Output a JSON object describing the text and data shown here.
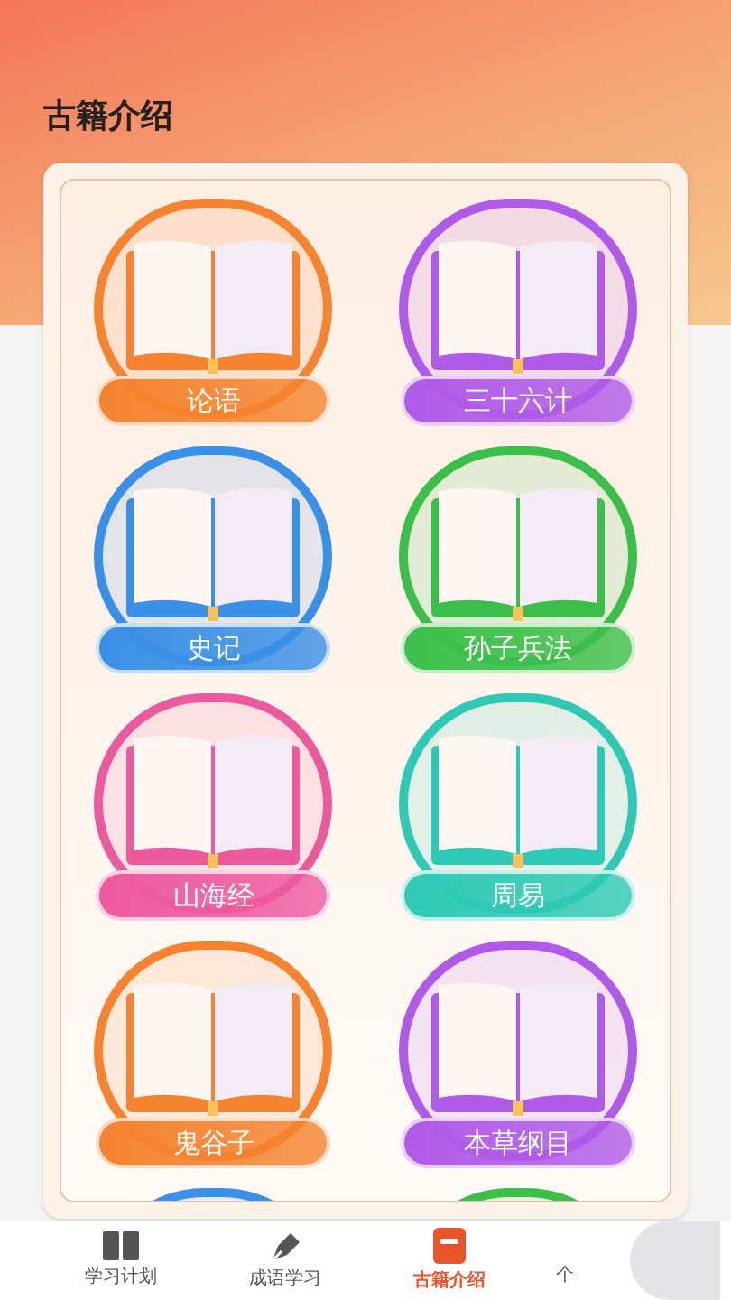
{
  "page_title": "古籍介绍",
  "books": [
    {
      "title": "论语",
      "color": "#f5832f"
    },
    {
      "title": "三十六计",
      "color": "#b05ae8"
    },
    {
      "title": "史记",
      "color": "#3a8fe6"
    },
    {
      "title": "孙子兵法",
      "color": "#3cbf4a"
    },
    {
      "title": "山海经",
      "color": "#ec5a9e"
    },
    {
      "title": "周易",
      "color": "#2ec9b5"
    },
    {
      "title": "鬼谷子",
      "color": "#f5832f"
    },
    {
      "title": "本草纲目",
      "color": "#b05ae8"
    },
    {
      "color": "#3a8fe6"
    },
    {
      "color": "#3cbf4a"
    }
  ],
  "tabs": [
    {
      "label": "学习计划",
      "kind": "book",
      "selected": false
    },
    {
      "label": "成语学习",
      "kind": "pen",
      "selected": false
    },
    {
      "label": "古籍介绍",
      "kind": "card",
      "selected": true
    },
    {
      "label": "个",
      "kind": "none",
      "selected": false
    }
  ]
}
